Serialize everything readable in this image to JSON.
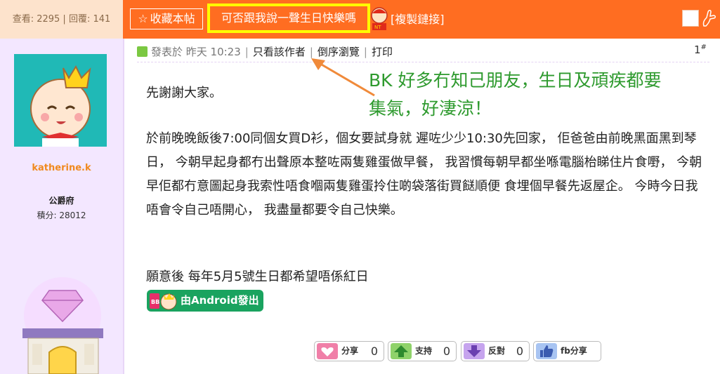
{
  "topbar": {
    "views_text": "查看: 2295 | 回覆: 141",
    "favorite_label": "收藏本帖",
    "thread_title": "可否跟我說一聲生日快樂嗎",
    "copy_link_label": "[複製鏈接]"
  },
  "author": {
    "username": "katherine.k",
    "group": "公爵府",
    "points": "積分: 28012"
  },
  "post_meta": {
    "posted": "發表於 昨天 10:23",
    "author_only": "只看該作者",
    "reverse": "倒序瀏覽",
    "print": "打印",
    "floor": "1",
    "floor_mark": "#"
  },
  "annotation": {
    "line1": "BK 好多冇知己朋友，生日及頑疾都要",
    "line2": "集氣，好淒涼！"
  },
  "post": {
    "para1": "先謝謝大家。",
    "para2": "於前晚晚飯後7:00同個女買D衫，個女要試身就 遲咗少少10:30先回家， 佢爸爸由前晚黑面黑到琴日， 今朝早起身都冇出聲原本整咗兩隻雞蛋做早餐， 我習慣每朝早都坐喺電腦枱睇住片食嘢， 今朝早佢都冇意圖起身我索性唔食嗰兩隻雞蛋拎住啲袋落街買餸順便 食埋個早餐先返屋企。 今時今日我唔會令自己唔開心， 我盡量都要令自己快樂。",
    "para3": "願意後 每年5月5號生日都希望唔係紅日",
    "android_badge": "由Android發出"
  },
  "actions": {
    "share_label": "分享",
    "share_count": "0",
    "support_label": "支持",
    "support_count": "0",
    "oppose_label": "反對",
    "oppose_count": "0",
    "fb_label": "fb分享"
  },
  "colors": {
    "topbar": "#ff6d21",
    "highlight_border": "#ffff00",
    "sidebar": "#f3e7ff",
    "username": "#f08a1f",
    "annotation": "#2e9a2e",
    "android_badge": "#1aa35f"
  },
  "icons": [
    "star-icon",
    "mascot-icon",
    "square-icon",
    "hand-icon",
    "user-icon",
    "heart-icon",
    "up-arrow-icon",
    "down-arrow-icon",
    "thumbs-up-icon"
  ]
}
